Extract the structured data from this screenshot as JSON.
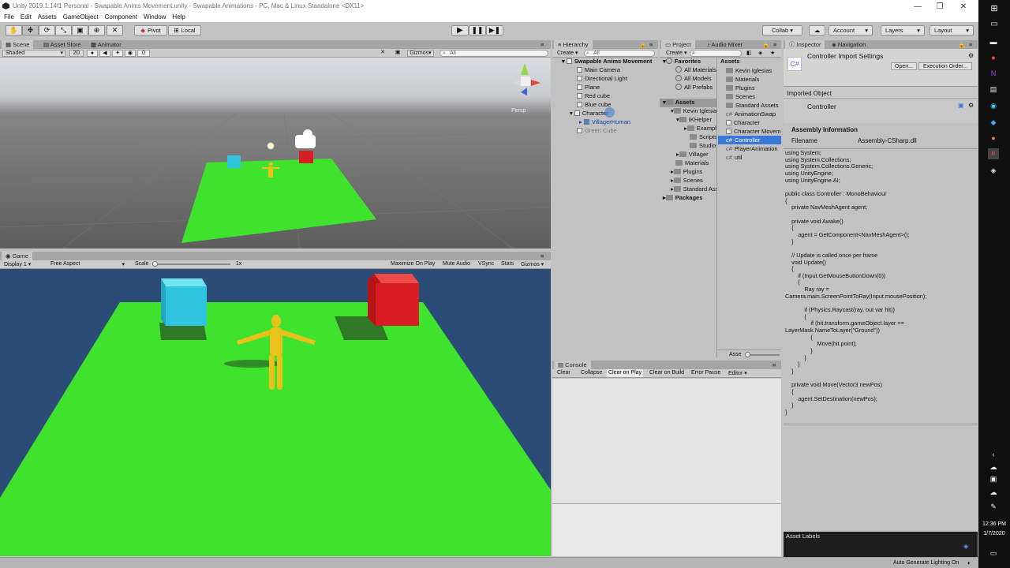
{
  "window": {
    "title": "Unity 2019.1.14f1 Personal - Swapable Anims Movement.unity - Swapable Animations - PC, Mac & Linux Standalone <DX11>",
    "controls": [
      "—",
      "❐",
      "✕"
    ]
  },
  "menu": [
    "File",
    "Edit",
    "Assets",
    "GameObject",
    "Component",
    "Window",
    "Help"
  ],
  "toolbar": {
    "pivot": "Pivot",
    "local": "Local",
    "collab": "Collab ▾",
    "account": "Account",
    "layers": "Layers",
    "layout": "Layout"
  },
  "scene": {
    "tabs": [
      "Scene",
      "Asset Store",
      "Animator"
    ],
    "shading": "Shaded",
    "mode_2d": "2D",
    "effects_count": "0",
    "gizmos": "Gizmos",
    "search_placeholder": "All",
    "persp": "Persp"
  },
  "game": {
    "tab": "Game",
    "display": "Display 1",
    "aspect": "Free Aspect",
    "scale_label": "Scale",
    "scale_value": "1x",
    "buttons": [
      "Maximize On Play",
      "Mute Audio",
      "VSync",
      "Stats",
      "Gizmos"
    ]
  },
  "hierarchy": {
    "tab": "Hierarchy",
    "create": "Create",
    "search_placeholder": "All",
    "scene_name": "Swapable Anims Movement",
    "items": [
      "Main Camera",
      "Directional Light",
      "Plane",
      "Red cube",
      "Blue cube",
      "Character",
      "VillagerHuman",
      "Green Cube"
    ]
  },
  "project": {
    "tabs": [
      "Project",
      "Audio Mixer"
    ],
    "create": "Create",
    "favorites_label": "Favorites",
    "favorites": [
      "All Materials",
      "All Models",
      "All Prefabs"
    ],
    "assets_label": "Assets",
    "tree": [
      "Kevin Iglesias",
      "IKHelper",
      "Examples",
      "Scripts",
      "Studio",
      "Villager",
      "Materials",
      "Plugins",
      "Scenes",
      "Standard Assets"
    ],
    "packages_label": "Packages",
    "breadcrumb": "Assets",
    "files": [
      "Kevin Iglesias",
      "Materials",
      "Plugins",
      "Scenes",
      "Standard Assets",
      "AnimationSwap",
      "Character",
      "Character Movement",
      "Controller",
      "PlayerAnimation",
      "util"
    ],
    "selected_file": "Controller",
    "slider_label": "Asse"
  },
  "inspector": {
    "tabs": [
      "Inspector",
      "Navigation"
    ],
    "header_title": "Controller Import Settings",
    "open_button": "Open...",
    "exec_order_button": "Execution Order...",
    "imported_object_label": "Imported Object",
    "object_name": "Controller",
    "assembly_info_label": "Assembly Information",
    "filename_label": "Filename",
    "filename_value": "Assembly-CSharp.dll",
    "code": "using System;\nusing System.Collections;\nusing System.Collections.Generic;\nusing UnityEngine;\nusing UnityEngine.AI;\n\npublic class Controller : MonoBehaviour\n{\n    private NavMeshAgent agent;\n\n    private void Awake()\n    {\n        agent = GetComponent<NavMeshAgent>();\n    }\n\n    // Update is called once per frame\n    void Update()\n    {\n        if (Input.GetMouseButtonDown(0))\n        {\n            Ray ray =\nCamera.main.ScreenPointToRay(Input.mousePosition);\n\n            if (Physics.Raycast(ray, out var hit))\n            {\n                if (hit.transform.gameObject.layer ==\nLayerMask.NameToLayer(\"Ground\"))\n                {\n                    Move(hit.point);\n                }\n            }\n        }\n    }\n\n    private void Move(Vector3 newPos)\n    {\n        agent.SetDestination(newPos);\n    }\n}",
    "asset_labels": "Asset Labels"
  },
  "console": {
    "tab": "Console",
    "buttons": [
      "Clear",
      "Collapse",
      "Clear on Play",
      "Clear on Build",
      "Error Pause",
      "Editor ▾"
    ]
  },
  "statusbar": {
    "text": "Auto Generate Lighting On"
  },
  "taskbar": {
    "time": "12:36 PM",
    "date": "1/7/2020"
  },
  "colors": {
    "ground": "#3fe22c",
    "sky": "#2c4c78",
    "blue_cube": "#2fc5e0",
    "red_cube": "#d81e23",
    "character": "#e8c21a",
    "selection": "#3a78d8"
  }
}
